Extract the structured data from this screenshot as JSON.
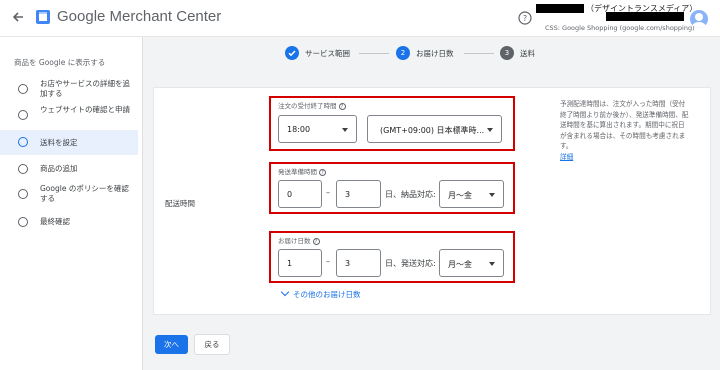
{
  "header": {
    "app_title": "Google Merchant Center",
    "account_name": "（デザイントランスメディア）",
    "account_sub": "CSS: Google Shopping (google.com/shopping)"
  },
  "sidebar": {
    "heading": "商品を Google に表示する",
    "items": [
      {
        "label": "お店やサービスの詳細を追加する"
      },
      {
        "label": "ウェブサイトの確認と申請"
      },
      {
        "label": "送料を設定"
      },
      {
        "label": "商品の追加"
      },
      {
        "label": "Google のポリシーを確認する"
      },
      {
        "label": "最終確認"
      }
    ]
  },
  "stepper": {
    "steps": [
      {
        "number": "1",
        "label": "サービス範囲",
        "status": "done"
      },
      {
        "number": "2",
        "label": "お届け日数",
        "status": "current"
      },
      {
        "number": "3",
        "label": "送料",
        "status": "upcoming"
      }
    ]
  },
  "form": {
    "section_label": "配送時間",
    "cutoff": {
      "label": "注文の受付終了時間",
      "time_value": "18:00",
      "timezone_value": "(GMT+09:00) 日本標準時..."
    },
    "handling": {
      "label": "発送準備時間",
      "min": "0",
      "dash": "–",
      "max": "3",
      "suffix": "日、納品対応:",
      "days_value": "月～金"
    },
    "transit": {
      "label": "お届け日数",
      "min": "1",
      "dash": "–",
      "max": "3",
      "suffix": "日、発送対応:",
      "days_value": "月～金"
    },
    "more_link": "その他のお届け日数"
  },
  "help": {
    "text": "予測配達時間は、注文が入った時間（受付終了時間より前か後か）、発送準備時間、配送時間を基に算出されます。期間中に祝日が含まれる場合は、その時間も考慮されます。",
    "link": "詳細"
  },
  "buttons": {
    "next": "次へ",
    "back": "戻る"
  },
  "colors": {
    "accent": "#1a73e8",
    "highlight_border": "#d40000",
    "done_step": "#1a73e8",
    "upcoming_step": "#5f6368"
  }
}
